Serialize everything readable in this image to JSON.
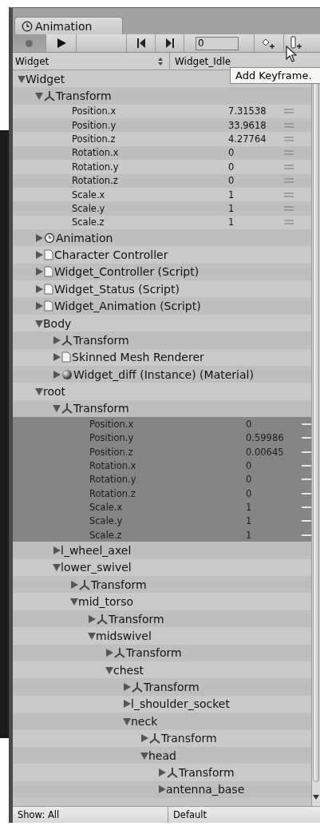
{
  "tab": {
    "label": "Animation"
  },
  "toolbar": {
    "buttons": [
      {
        "kind": "record",
        "pressed": true
      },
      {
        "kind": "play",
        "pressed": false
      },
      {
        "kind": "spacer",
        "pressed": false
      },
      {
        "kind": "prev_key",
        "pressed": false
      },
      {
        "kind": "next_key",
        "pressed": false
      },
      {
        "kind": "frame",
        "pressed": false,
        "value": "0"
      },
      {
        "kind": "add_keyframe",
        "pressed": false
      },
      {
        "kind": "add_event",
        "pressed": false
      }
    ]
  },
  "object_selector": {
    "value": "Widget"
  },
  "clip_selector": {
    "value": "Widget_Idle"
  },
  "tooltip": {
    "text": "Add Keyframe."
  },
  "tree": [
    {
      "kind": "gameobject",
      "label": "Widget",
      "expanded": true,
      "children": [
        {
          "kind": "transform",
          "label": "Transform",
          "expanded": true,
          "children": [
            {
              "kind": "property",
              "label": "Position.x",
              "value": "7.31538",
              "selected": false
            },
            {
              "kind": "property",
              "label": "Position.y",
              "value": "33.9618",
              "selected": false
            },
            {
              "kind": "property",
              "label": "Position.z",
              "value": "4.27764",
              "selected": false
            },
            {
              "kind": "property",
              "label": "Rotation.x",
              "value": "0",
              "selected": false
            },
            {
              "kind": "property",
              "label": "Rotation.y",
              "value": "0",
              "selected": false
            },
            {
              "kind": "property",
              "label": "Rotation.z",
              "value": "0",
              "selected": false
            },
            {
              "kind": "property",
              "label": "Scale.x",
              "value": "1",
              "selected": false
            },
            {
              "kind": "property",
              "label": "Scale.y",
              "value": "1",
              "selected": false
            },
            {
              "kind": "property",
              "label": "Scale.z",
              "value": "1",
              "selected": false
            }
          ]
        },
        {
          "kind": "animation",
          "label": "Animation",
          "expanded": false
        },
        {
          "kind": "component",
          "label": "Character Controller",
          "expanded": false
        },
        {
          "kind": "component",
          "label": "Widget_Controller (Script)",
          "expanded": false
        },
        {
          "kind": "component",
          "label": "Widget_Status (Script)",
          "expanded": false
        },
        {
          "kind": "component",
          "label": "Widget_Animation (Script)",
          "expanded": false
        },
        {
          "kind": "gameobject",
          "label": "Body",
          "expanded": true,
          "children": [
            {
              "kind": "transform",
              "label": "Transform",
              "expanded": false
            },
            {
              "kind": "component",
              "label": "Skinned Mesh Renderer",
              "expanded": false
            },
            {
              "kind": "material",
              "label": "Widget_diff (Instance) (Material)",
              "expanded": false
            }
          ]
        },
        {
          "kind": "gameobject",
          "label": "root",
          "expanded": true,
          "children": [
            {
              "kind": "transform",
              "label": "Transform",
              "expanded": true,
              "children": [
                {
                  "kind": "property",
                  "label": "Position.x",
                  "value": "0",
                  "selected": true
                },
                {
                  "kind": "property",
                  "label": "Position.y",
                  "value": "0.59986",
                  "selected": true
                },
                {
                  "kind": "property",
                  "label": "Position.z",
                  "value": "0.00645",
                  "selected": true
                },
                {
                  "kind": "property",
                  "label": "Rotation.x",
                  "value": "0",
                  "selected": true
                },
                {
                  "kind": "property",
                  "label": "Rotation.y",
                  "value": "0",
                  "selected": true
                },
                {
                  "kind": "property",
                  "label": "Rotation.z",
                  "value": "0",
                  "selected": true
                },
                {
                  "kind": "property",
                  "label": "Scale.x",
                  "value": "1",
                  "selected": true
                },
                {
                  "kind": "property",
                  "label": "Scale.y",
                  "value": "1",
                  "selected": true
                },
                {
                  "kind": "property",
                  "label": "Scale.z",
                  "value": "1",
                  "selected": true
                }
              ]
            },
            {
              "kind": "gameobject",
              "label": "l_wheel_axel",
              "expanded": false
            },
            {
              "kind": "gameobject",
              "label": "lower_swivel",
              "expanded": true,
              "children": [
                {
                  "kind": "transform",
                  "label": "Transform",
                  "expanded": false
                },
                {
                  "kind": "gameobject",
                  "label": "mid_torso",
                  "expanded": true,
                  "children": [
                    {
                      "kind": "transform",
                      "label": "Transform",
                      "expanded": false
                    },
                    {
                      "kind": "gameobject",
                      "label": "midswivel",
                      "expanded": true,
                      "children": [
                        {
                          "kind": "transform",
                          "label": "Transform",
                          "expanded": false
                        },
                        {
                          "kind": "gameobject",
                          "label": "chest",
                          "expanded": true,
                          "children": [
                            {
                              "kind": "transform",
                              "label": "Transform",
                              "expanded": false
                            },
                            {
                              "kind": "gameobject",
                              "label": "l_shoulder_socket",
                              "expanded": false
                            },
                            {
                              "kind": "gameobject",
                              "label": "neck",
                              "expanded": true,
                              "children": [
                                {
                                  "kind": "transform",
                                  "label": "Transform",
                                  "expanded": false
                                },
                                {
                                  "kind": "gameobject",
                                  "label": "head",
                                  "expanded": true,
                                  "children": [
                                    {
                                      "kind": "transform",
                                      "label": "Transform",
                                      "expanded": false
                                    },
                                    {
                                      "kind": "gameobject",
                                      "label": "antenna_base",
                                      "expanded": false
                                    }
                                  ]
                                }
                              ]
                            }
                          ]
                        }
                      ]
                    }
                  ]
                }
              ]
            }
          ]
        }
      ]
    }
  ],
  "status_bar": {
    "filter": "Show: All",
    "mode": "Default"
  }
}
